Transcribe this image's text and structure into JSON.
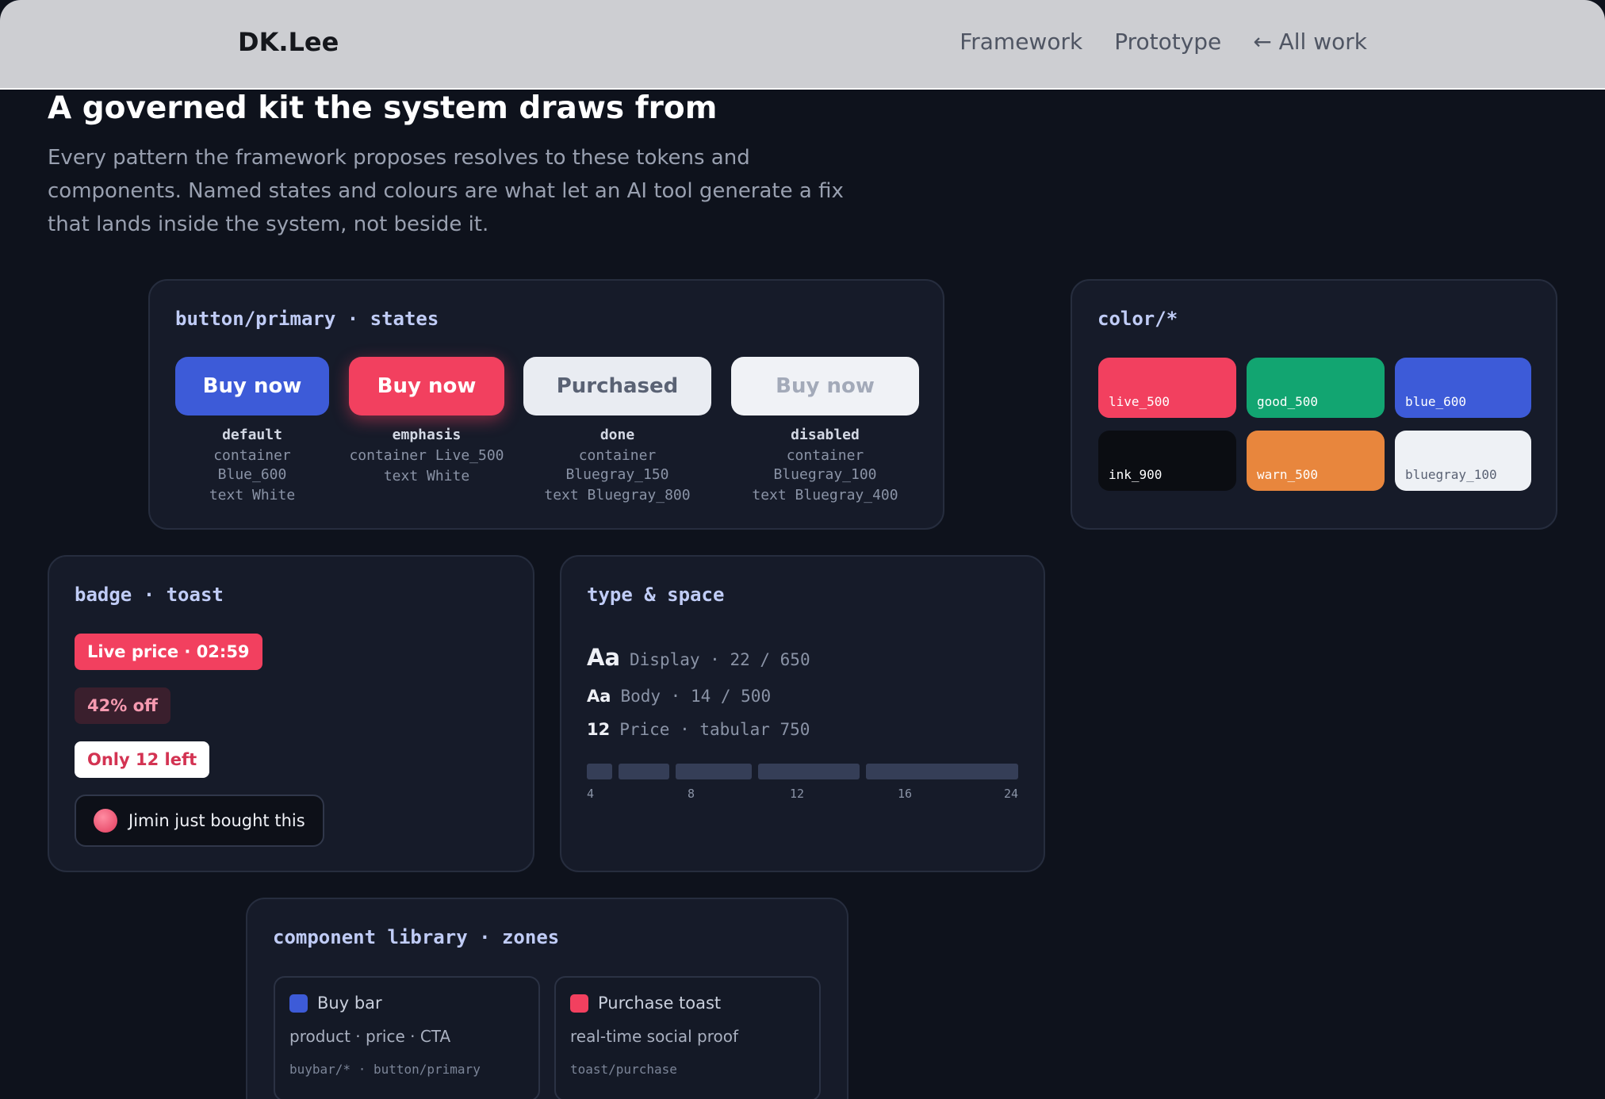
{
  "header": {
    "brand": "DK.Lee",
    "nav": [
      "Framework",
      "Prototype",
      "← All work"
    ]
  },
  "hero": {
    "title": "A governed kit the system draws from",
    "description": "Every pattern the framework proposes resolves to these tokens and components. Named states and colours are what let an AI tool generate a fix that lands inside the system, not beside it."
  },
  "buttons_card": {
    "title": "button/primary · states",
    "states": [
      {
        "label": "Buy now",
        "name": "default",
        "container": "container Blue_600",
        "text": "text White"
      },
      {
        "label": "Buy now",
        "name": "emphasis",
        "container": "container Live_500",
        "text": "text White"
      },
      {
        "label": "Purchased",
        "name": "done",
        "container": "container Bluegray_150",
        "text": "text Bluegray_800"
      },
      {
        "label": "Buy now",
        "name": "disabled",
        "container": "container Bluegray_100",
        "text": "text Bluegray_400"
      }
    ]
  },
  "colors_card": {
    "title": "color/*",
    "swatches": [
      {
        "name": "live_500",
        "hex": "#f2405f",
        "text": "#ffffff"
      },
      {
        "name": "good_500",
        "hex": "#12a571",
        "text": "#ffffff"
      },
      {
        "name": "blue_600",
        "hex": "#3d5bd8",
        "text": "#ffffff"
      },
      {
        "name": "ink_900",
        "hex": "#0b0d12",
        "text": "#ffffff"
      },
      {
        "name": "warn_500",
        "hex": "#e8863d",
        "text": "#ffffff"
      },
      {
        "name": "bluegray_100",
        "hex": "#eef1f5",
        "text": "#5a6274"
      }
    ]
  },
  "badge_card": {
    "title": "badge · toast",
    "badges": [
      "Live price · 02:59",
      "42% off",
      "Only 12 left"
    ],
    "toast": "Jimin just bought this"
  },
  "type_card": {
    "title": "type & space",
    "rows": [
      {
        "sample": "Aa",
        "meta": "Display · 22 / 650"
      },
      {
        "sample": "Aa",
        "meta": "Body · 14 / 500"
      },
      {
        "sample": "12",
        "meta": "Price · tabular 750"
      }
    ],
    "spacing_scale": [
      "4",
      "8",
      "12",
      "16",
      "24"
    ]
  },
  "library_card": {
    "title": "component library · zones",
    "zones": [
      {
        "title": "Buy bar",
        "desc": "product · price · CTA",
        "code": "buybar/* · button/primary",
        "color": "#3d5bd8"
      },
      {
        "title": "Purchase toast",
        "desc": "real-time social proof",
        "code": "toast/purchase",
        "color": "#f2405f"
      }
    ]
  }
}
